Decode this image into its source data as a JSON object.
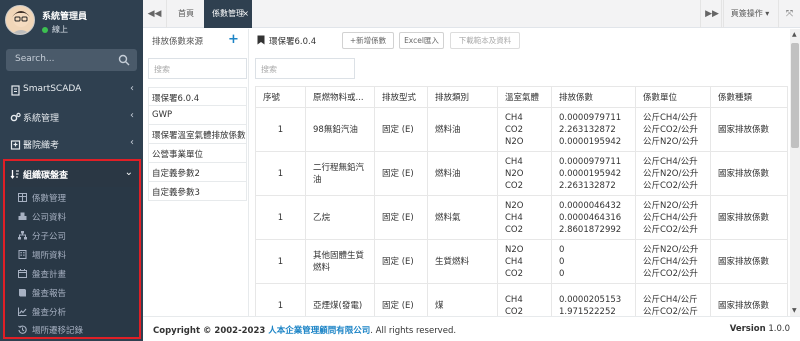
{
  "user": {
    "name": "系統管理員",
    "status": "線上"
  },
  "sidebar": {
    "search_placeholder": "Search...",
    "items": [
      {
        "label": "SmartSCADA",
        "arrow": "‹"
      },
      {
        "label": "系統管理",
        "arrow": "‹"
      },
      {
        "label": "醫院織考",
        "arrow": "‹"
      }
    ],
    "active_group": {
      "label": "組織碳盤查",
      "arrow": "⌄",
      "sub_items": [
        {
          "label": "係數管理"
        },
        {
          "label": "公司資料"
        },
        {
          "label": "分子公司"
        },
        {
          "label": "場所資料"
        },
        {
          "label": "盤查計畫"
        },
        {
          "label": "盤查報告"
        },
        {
          "label": "盤查分析"
        },
        {
          "label": "場所遷移記錄"
        }
      ]
    }
  },
  "topbar": {
    "back": "◀◀",
    "home_tab": "首頁",
    "active_tab": "係數管理",
    "active_tab_close": "×",
    "forward": "▶▶",
    "ops": "頁簽操作 ▾",
    "fullscreen": "⤧"
  },
  "list_panel": {
    "title": "排放係數來源",
    "add": "+",
    "search_placeholder": "搜索",
    "items": [
      "環保署6.0.4",
      "GWP",
      "環保署溫室氣體排放係數",
      "公營事業單位",
      "自定義參數2",
      "自定義參數3"
    ]
  },
  "main": {
    "title": "環保署6.0.4",
    "buttons": {
      "add": "+新增係數",
      "excel": "Excel匯入",
      "download": "下載範本及資料"
    },
    "search_placeholder": "搜索",
    "columns": [
      "序號",
      "原燃物料或...",
      "排放型式",
      "排放類別",
      "溫室氣體",
      "排放係數",
      "係數單位",
      "係數種類"
    ],
    "rows": [
      {
        "no": "1",
        "material": "98無鉛汽油",
        "type": "固定 (E)",
        "category": "燃料油",
        "gases": [
          "CH4",
          "CO2",
          "N2O"
        ],
        "factors": [
          "0.0000979711",
          "2.263132872",
          "0.0000195942"
        ],
        "units": [
          "公斤CH4/公升",
          "公斤CO2/公升",
          "公斤N2O/公升"
        ],
        "kind": "國家排放係數"
      },
      {
        "no": "1",
        "material": "二行程無鉛汽油",
        "type": "固定 (E)",
        "category": "燃料油",
        "gases": [
          "CH4",
          "N2O",
          "CO2"
        ],
        "factors": [
          "0.0000979711",
          "0.0000195942",
          "2.263132872"
        ],
        "units": [
          "公斤CH4/公升",
          "公斤N2O/公升",
          "公斤CO2/公升"
        ],
        "kind": "國家排放係數"
      },
      {
        "no": "1",
        "material": "乙烷",
        "type": "固定 (E)",
        "category": "燃料氣",
        "gases": [
          "N2O",
          "CH4",
          "CO2"
        ],
        "factors": [
          "0.0000046432",
          "0.0000464316",
          "2.8601872992"
        ],
        "units": [
          "公斤N2O/公升",
          "公斤CH4/公升",
          "公斤CO2/公升"
        ],
        "kind": "國家排放係數"
      },
      {
        "no": "1",
        "material": "其他固體生質燃料",
        "type": "固定 (E)",
        "category": "生質燃料",
        "gases": [
          "N2O",
          "CH4",
          "CO2"
        ],
        "factors": [
          "0",
          "0",
          "0"
        ],
        "units": [
          "公斤N2O/公升",
          "公斤CH4/公升",
          "公斤CO2/公升"
        ],
        "kind": "國家排放係數"
      },
      {
        "no": "1",
        "material": "亞煙煤(發電)",
        "type": "固定 (E)",
        "category": "煤",
        "gases": [
          "CH4",
          "CO2"
        ],
        "factors": [
          "0.0000205153",
          "1.971522252"
        ],
        "units": [
          "公斤CH4/公斤",
          "公斤CO2/公斤"
        ],
        "kind": "國家排放係數"
      }
    ]
  },
  "footer": {
    "copy_prefix": "Copyright © 2002-2023 ",
    "copy_link": "人本企業管理顧問有限公司",
    "copy_suffix": ". All rights reserved.",
    "version_label": "Version",
    "version": "1.0.0"
  },
  "colors": {
    "sidebar_bg": "#2f4050",
    "highlight_border": "#e01f26",
    "link": "#1c84c6",
    "active_tab": "#2f4050"
  }
}
